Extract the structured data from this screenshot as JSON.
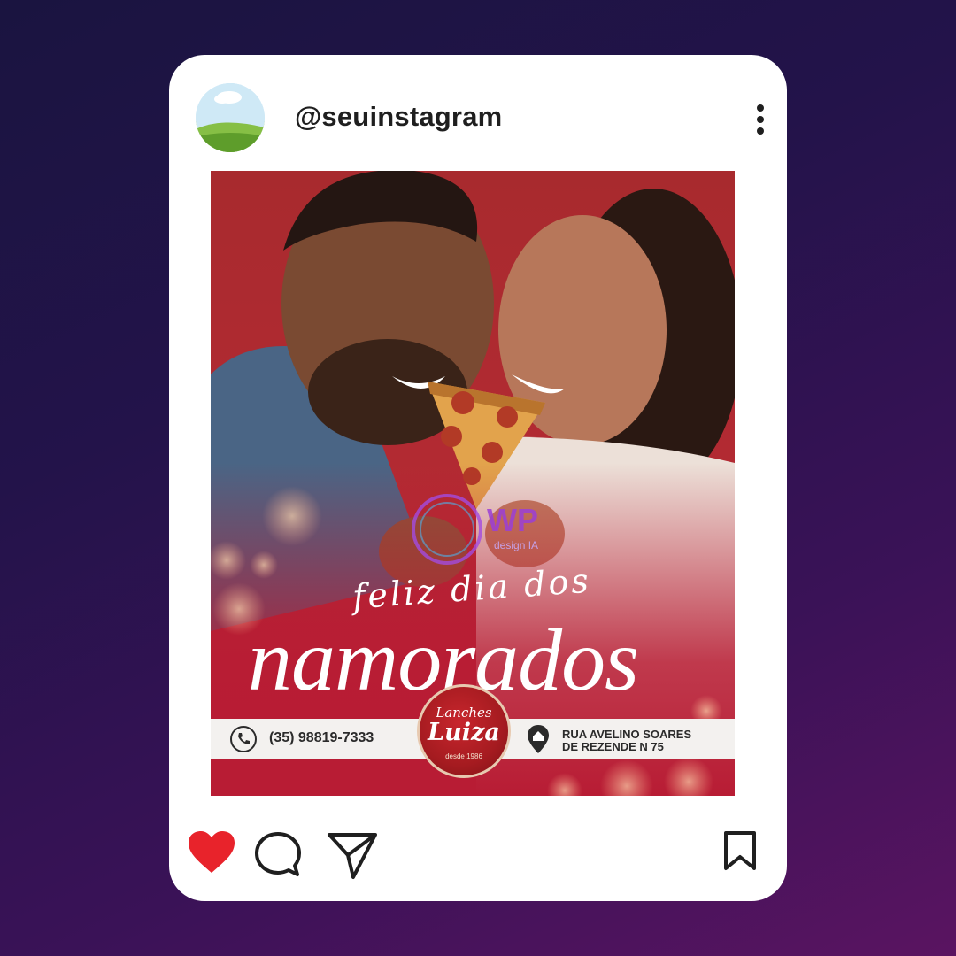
{
  "profile": {
    "username": "@seuinstagram",
    "avatar": "landscape-avatar"
  },
  "menu_icon": "more-vertical-icon",
  "post": {
    "headline_small": "feliz dia dos",
    "headline_big": "namorados",
    "phone": "(35) 98819-7333",
    "address_line1": "RUA AVELINO SOARES",
    "address_line2": "DE REZENDE N 75",
    "logo": {
      "top": "Lanches",
      "main": "Luiza",
      "sub": "desde 1986"
    },
    "watermark": {
      "brand": "WP",
      "sub": "design IA"
    }
  },
  "actions": {
    "like": "heart-icon",
    "comment": "comment-icon",
    "share": "send-icon",
    "save": "bookmark-icon"
  },
  "colors": {
    "brand_red": "#b82533",
    "like_red": "#e8232b",
    "background_top": "#1a1440",
    "background_bottom": "#5a1461"
  }
}
